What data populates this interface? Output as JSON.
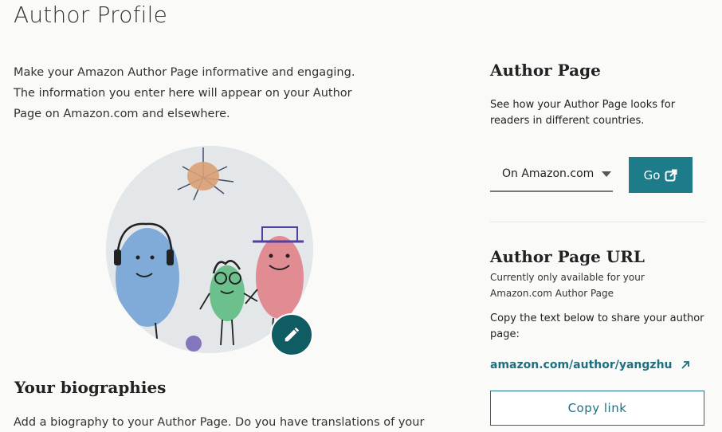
{
  "page": {
    "title": "Author Profile"
  },
  "intro": {
    "text": "Make your Amazon Author Page informative and engaging. The information you enter here will appear on your Author Page on Amazon.com and elsewhere."
  },
  "biographies": {
    "heading": "Your biographies",
    "text": "Add a biography to your Author Page. Do you have translations of your"
  },
  "author_page": {
    "heading": "Author Page",
    "description": "See how your Author Page looks for readers in different countries.",
    "select_value": "On Amazon.com",
    "go_label": "Go"
  },
  "author_page_url": {
    "heading": "Author Page URL",
    "note": "Currently only available for your Amazon.com Author Page",
    "copy_hint": "Copy the text below to share your author page:",
    "url": "amazon.com/author/yangzhu",
    "copy_label": "Copy link"
  },
  "colors": {
    "accent": "#1e7c8a",
    "link": "#1e6f80",
    "edit_button": "#0f5d63"
  },
  "icons": [
    "pencil-icon",
    "external-link-icon",
    "arrow-up-right-icon",
    "chevron-down-icon"
  ]
}
